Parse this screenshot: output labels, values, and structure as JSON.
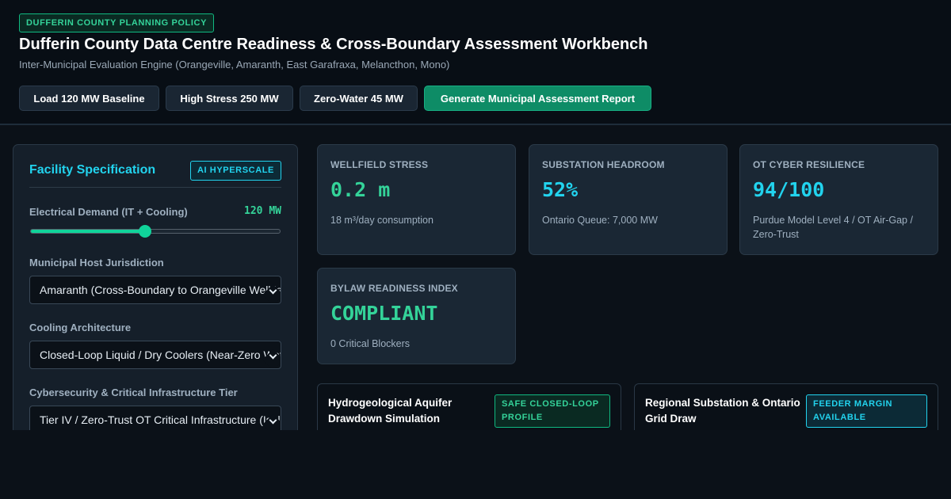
{
  "header": {
    "policy_badge": "DUFFERIN COUNTY PLANNING POLICY",
    "title": "Dufferin County Data Centre Readiness & Cross-Boundary Assessment Workbench",
    "subtitle": "Inter-Municipal Evaluation Engine (Orangeville, Amaranth, East Garafraxa, Melancthon, Mono)"
  },
  "actions": {
    "baseline": "Load 120 MW Baseline",
    "high_stress": "High Stress 250 MW",
    "zero_water": "Zero-Water 45 MW",
    "report": "Generate Municipal Assessment Report"
  },
  "facility": {
    "title": "Facility Specification",
    "badge": "AI HYPERSCALE",
    "demand_label": "Electrical Demand (IT + Cooling)",
    "demand_value": "120 MW",
    "demand_slider_fraction": 0.46,
    "jurisdiction_label": "Municipal Host Jurisdiction",
    "jurisdiction_value": "Amaranth (Cross-Boundary to Orangeville Wellfield)",
    "cooling_label": "Cooling Architecture",
    "cooling_value": "Closed-Loop Liquid / Dry Coolers (Near-Zero Water)",
    "cyber_label": "Cybersecurity & Critical Infrastructure Tier",
    "cyber_value": "Tier IV / Zero-Trust OT Critical Infrastructure (Isolated)"
  },
  "metrics": {
    "wellfield": {
      "label": "WELLFIELD STRESS",
      "value": "0.2 m",
      "sub": "18 m³/day consumption",
      "color": "#34d399"
    },
    "substation": {
      "label": "SUBSTATION HEADROOM",
      "value": "52%",
      "sub": "Ontario Queue: 7,000 MW",
      "color": "#22d3ee"
    },
    "cyber": {
      "label": "OT CYBER RESILIENCE",
      "value": "94/100",
      "sub": "Purdue Model Level 4 / OT Air-Gap / Zero-Trust",
      "color": "#22d3ee"
    },
    "bylaw": {
      "label": "BYLAW READINESS INDEX",
      "value": "COMPLIANT",
      "sub": "0 Critical Blockers",
      "color": "#34d399"
    }
  },
  "simulations": {
    "aquifer": {
      "title": "Hydrogeological Aquifer Drawdown Simulation",
      "badge": "SAFE CLOSED-LOOP PROFILE"
    },
    "grid": {
      "title": "Regional Substation & Ontario Grid Draw",
      "badge": "FEEDER MARGIN AVAILABLE"
    }
  }
}
